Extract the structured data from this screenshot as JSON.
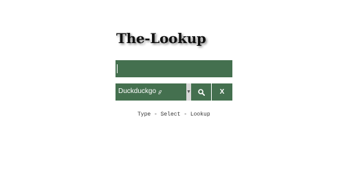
{
  "app": {
    "title": "The-Lookup"
  },
  "search": {
    "value": "",
    "placeholder": ""
  },
  "engine_select": {
    "selected": "Duckduckgo",
    "badge": "ℊ",
    "arrow_icon": "chevron-down-icon"
  },
  "buttons": {
    "lookup_icon": "search-icon",
    "clear_label": "X"
  },
  "instructions": "Type - Select - Lookup",
  "colors": {
    "accent": "#44704f",
    "arrow_bg": "#d8d8d8"
  }
}
